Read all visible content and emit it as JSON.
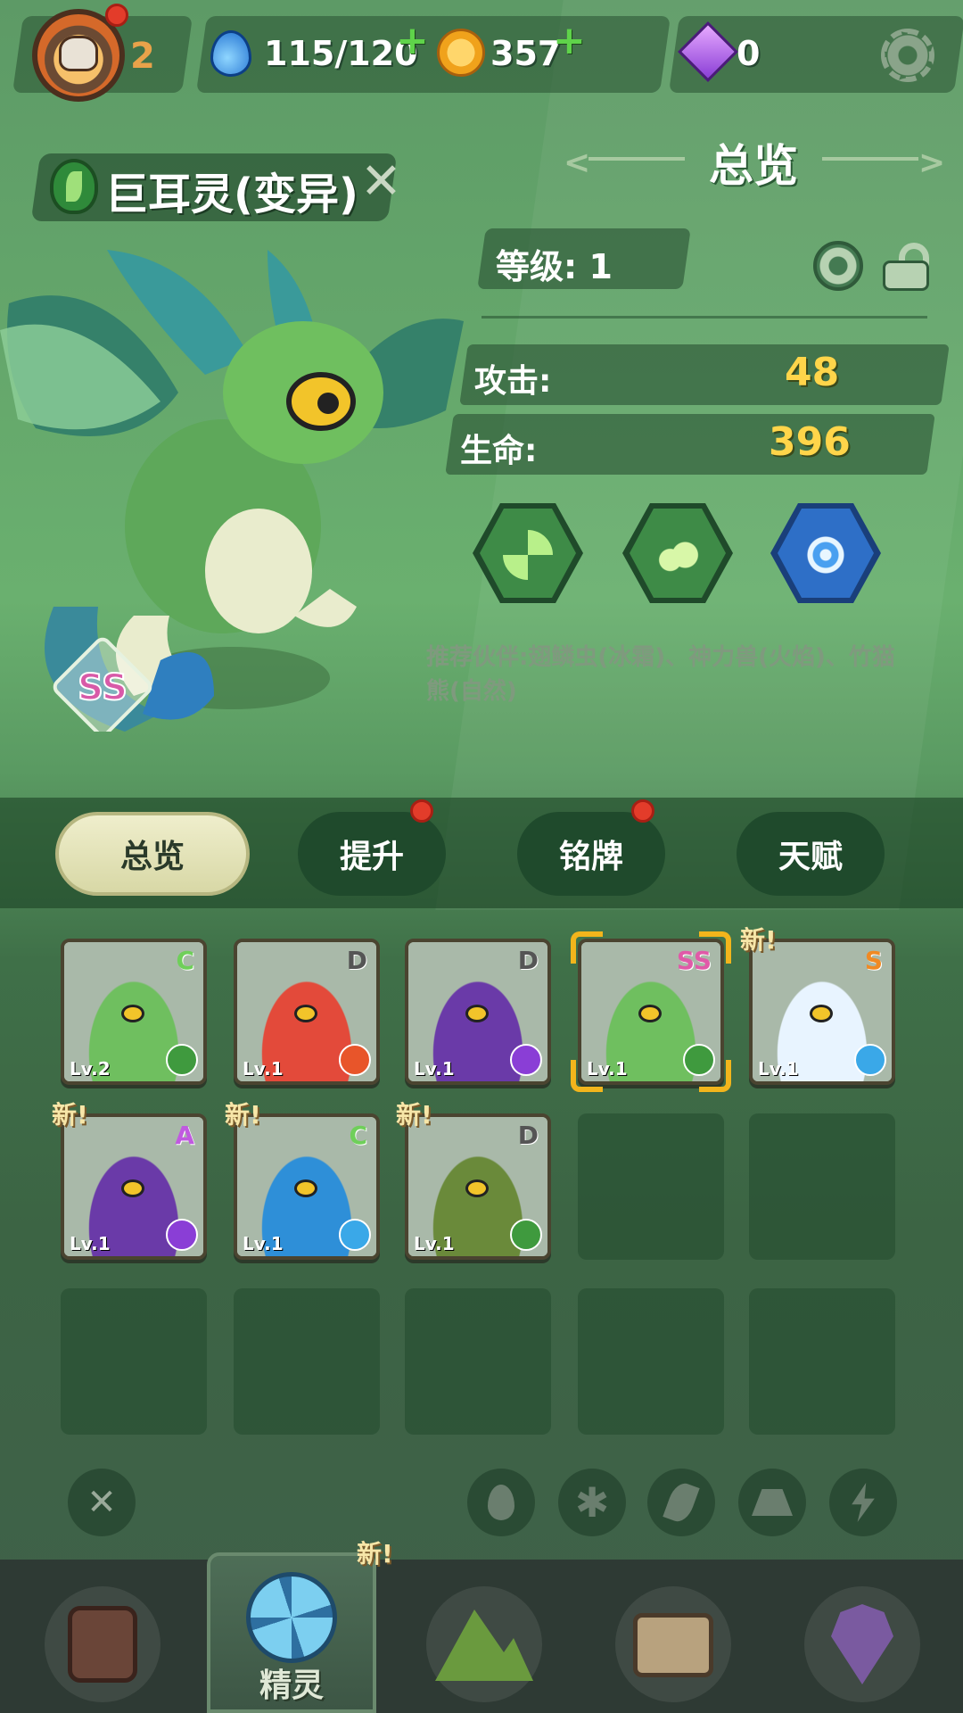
{
  "topbar": {
    "player_level": "2",
    "energy": "115/120",
    "coins": "357",
    "gems": "0",
    "plus_symbol": "+"
  },
  "pet": {
    "name": "巨耳灵(变异)",
    "grade": "SS",
    "element_icon": "leaf-icon"
  },
  "overview": {
    "title": "总览",
    "level_label": "等级:",
    "level_value": "1",
    "stats": [
      {
        "label": "攻击:",
        "value": "48"
      },
      {
        "label": "生命:",
        "value": "396"
      }
    ],
    "skills": [
      {
        "icon": "whirlwind-icon",
        "color": "#3e8b47"
      },
      {
        "icon": "seeds-icon",
        "color": "#3e8b47"
      },
      {
        "icon": "vortex-icon",
        "color": "#2e6fc7"
      }
    ],
    "recommend": "推荐伙伴:翅鳞虫(冰霜)、神力兽(火焰)、竹猫熊(自然)"
  },
  "tabs": [
    {
      "label": "总览",
      "active": true,
      "badge": false
    },
    {
      "label": "提升",
      "active": false,
      "badge": true
    },
    {
      "label": "铭牌",
      "active": false,
      "badge": true
    },
    {
      "label": "天赋",
      "active": false,
      "badge": false
    }
  ],
  "pets_grid": [
    {
      "rank": "C",
      "level": "Lv.2",
      "element": "nature",
      "new": false,
      "selected": false,
      "rank_color": "#6fcf5a"
    },
    {
      "rank": "D",
      "level": "Lv.1",
      "element": "fire",
      "new": false,
      "selected": false,
      "rank_color": "#555555"
    },
    {
      "rank": "D",
      "level": "Lv.1",
      "element": "thunder",
      "new": false,
      "selected": false,
      "rank_color": "#555555"
    },
    {
      "rank": "SS",
      "level": "Lv.1",
      "element": "nature",
      "new": false,
      "selected": true,
      "rank_color": "#e05aa8"
    },
    {
      "rank": "S",
      "level": "Lv.1",
      "element": "ice",
      "new": true,
      "selected": false,
      "rank_color": "#f08a24"
    },
    {
      "rank": "A",
      "level": "Lv.1",
      "element": "thunder",
      "new": true,
      "selected": false,
      "rank_color": "#c05ae0"
    },
    {
      "rank": "C",
      "level": "Lv.1",
      "element": "ice",
      "new": true,
      "selected": false,
      "rank_color": "#6fcf5a"
    },
    {
      "rank": "D",
      "level": "Lv.1",
      "element": "nature",
      "new": true,
      "selected": false,
      "rank_color": "#555555"
    }
  ],
  "new_label": "新!",
  "filters": [
    "close-icon",
    "fire-icon",
    "ice-icon",
    "leaf-icon",
    "earth-icon",
    "thunder-icon"
  ],
  "bottom_nav": {
    "active_label": "精灵",
    "new_label": "新!",
    "items": [
      "tablet-icon",
      "spirit-icon",
      "mountain-icon",
      "chest-icon",
      "map-pin-icon"
    ]
  },
  "colors": {
    "fire": "#e8552a",
    "ice": "#3aa8e8",
    "nature": "#3f9a3e",
    "thunder": "#8a3ed6",
    "accent_gold": "#ffd54a"
  }
}
